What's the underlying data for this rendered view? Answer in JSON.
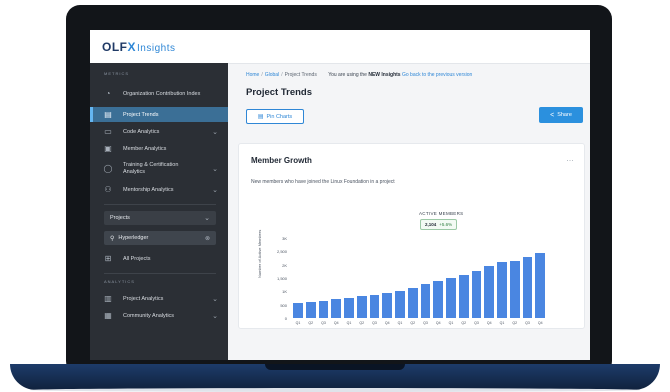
{
  "app": {
    "logo_main": "OLF",
    "logo_x": "X",
    "logo_sub": "Insights"
  },
  "sidebar": {
    "section_top": "Metrics",
    "items": [
      {
        "label": "Organization Contribution Index",
        "icon": "chart-pie-icon",
        "active": false
      },
      {
        "label": "Project Trends",
        "icon": "table-icon",
        "active": true
      },
      {
        "label": "Code Analytics",
        "icon": "code-icon",
        "active": false,
        "chevron": true
      },
      {
        "label": "Member Analytics",
        "icon": "id-card-icon",
        "active": false
      },
      {
        "label": "Training & Certification Analytics",
        "icon": "globe-icon",
        "active": false,
        "chevron": true
      },
      {
        "label": "Mentorship Analytics",
        "icon": "people-icon",
        "active": false,
        "chevron": true
      }
    ],
    "projects_select": "Projects",
    "search_value": "Hyperledger",
    "all_projects": "All Projects",
    "section_bottom": "Analytics",
    "bottom_items": [
      {
        "label": "Project Analytics",
        "icon": "bar-icon",
        "chevron": true
      },
      {
        "label": "Community Analytics",
        "icon": "group-icon",
        "chevron": true
      }
    ]
  },
  "breadcrumb": {
    "home": "Home",
    "global": "Global",
    "current": "Project Trends",
    "note_prefix": "You are using the",
    "note_bold": "NEW Insights",
    "note_link": "Go back to the previous version"
  },
  "page": {
    "title": "Project Trends",
    "pin_label": "Pin Charts",
    "share_label": "Share"
  },
  "card": {
    "title": "Member Growth",
    "menu": "…",
    "description": "New members who have joined the Linux Foundation in a project",
    "tooltip_label": "ACTIVE MEMBERS",
    "tooltip_value": "2,104",
    "tooltip_change": "+5.6%"
  },
  "chart_data": {
    "type": "bar",
    "ylabel": "Number of Active Members",
    "yticks": [
      "3K",
      "2,500",
      "2K",
      "1,500",
      "1K",
      "500",
      "0"
    ],
    "ylim": [
      0,
      3000
    ],
    "categories": [
      "Q1",
      "Q2",
      "Q3",
      "Q4",
      "Q1",
      "Q2",
      "Q3",
      "Q4",
      "Q1",
      "Q2",
      "Q3",
      "Q4",
      "Q1",
      "Q2",
      "Q3",
      "Q4",
      "Q1",
      "Q2",
      "Q3",
      "Q4"
    ],
    "values": [
      580,
      610,
      650,
      700,
      760,
      820,
      880,
      920,
      1000,
      1120,
      1280,
      1400,
      1500,
      1600,
      1750,
      1950,
      2100,
      2150,
      2300,
      2440
    ],
    "color": "#4a86e1"
  }
}
